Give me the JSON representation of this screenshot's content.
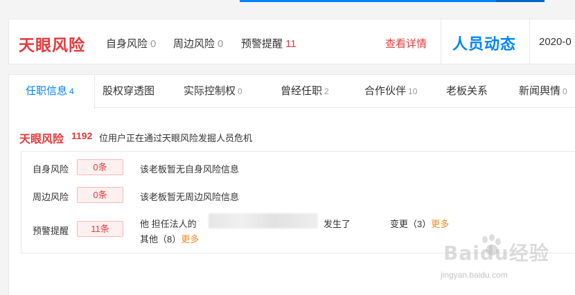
{
  "risk_strip": {
    "logo": "天眼风险",
    "items": [
      {
        "label": "自身风险",
        "count": "0"
      },
      {
        "label": "周边风险",
        "count": "0"
      },
      {
        "label": "预警提醒",
        "count": "11"
      }
    ],
    "detail_link": "查看详情",
    "dynamics_title": "人员动态",
    "dynamics_date": "2020-0"
  },
  "tabs": [
    {
      "label": "任职信息",
      "count": "4",
      "active": true
    },
    {
      "label": "股权穿透图",
      "count": ""
    },
    {
      "label": "实际控制权",
      "count": "0"
    },
    {
      "label": "曾经任职",
      "count": "2"
    },
    {
      "label": "合作伙伴",
      "count": "10"
    },
    {
      "label": "老板关系",
      "count": ""
    },
    {
      "label": "新闻舆情",
      "count": "0"
    }
  ],
  "summary": {
    "logo": "天眼风险",
    "user_count": "1192",
    "description": "位用户正在通过天眼风险发掘人员危机"
  },
  "risk_rows": [
    {
      "label": "自身风险",
      "badge": "0条",
      "text": "该老板暂无自身风险信息"
    },
    {
      "label": "周边风险",
      "badge": "0条",
      "text": "该老板暂无周边风险信息"
    },
    {
      "label": "预警提醒",
      "badge": "11条",
      "text_prefix": "他 担任法人的",
      "text_suffix": "发生了",
      "change_label": "变更（3）",
      "other_label": "其他（8）",
      "more": "更多"
    }
  ],
  "watermark": {
    "main": "Baidu经验",
    "sub": "jingyan.baidu.com"
  },
  "colors": {
    "accent_red": "#e4393c",
    "accent_blue": "#0084ff",
    "more_orange": "#f08a24"
  }
}
